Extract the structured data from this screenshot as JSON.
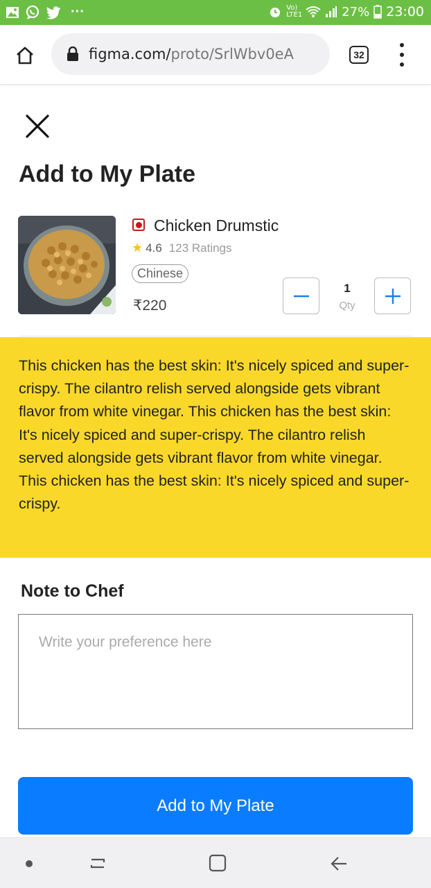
{
  "status_bar": {
    "battery": "27%",
    "time": "23:00",
    "network": "Vo) LTE1",
    "more": "···"
  },
  "browser": {
    "url_domain": "figma.com/",
    "url_path": "proto/SrlWbv0eA",
    "tab_count": "32"
  },
  "page": {
    "title": "Add to My Plate"
  },
  "product": {
    "name": "Chicken Drumstic",
    "rating": "4.6",
    "ratings_count": "123 Ratings",
    "cuisine": "Chinese",
    "price": "₹220",
    "quantity": "1",
    "qty_label": "Qty",
    "description": "This chicken has the best skin: It's nicely spiced and super-crispy. The cilantro relish served alongside gets vibrant flavor from white vinegar. This chicken has the best skin: It's nicely spiced and super-crispy. The cilantro relish served alongside gets vibrant flavor from white vinegar. This chicken has the best skin: It's nicely spiced and super-crispy."
  },
  "note": {
    "label": "Note to Chef",
    "placeholder": "Write your preference here",
    "value": ""
  },
  "cta": {
    "label": "Add to My Plate"
  },
  "colors": {
    "status_bar": "#6cbf45",
    "description_bg": "#f9d829",
    "primary": "#0a7cff",
    "non_veg_marker": "#c21b1b",
    "star": "#f5c518"
  },
  "icons": {
    "status_left": [
      "gallery-icon",
      "whatsapp-icon",
      "twitter-icon"
    ],
    "status_right": [
      "alarm-icon",
      "wifi-icon",
      "signal-icon",
      "battery-icon"
    ],
    "browser": [
      "home-icon",
      "lock-icon",
      "tabs-icon",
      "overflow-menu-icon"
    ],
    "content": [
      "close-icon",
      "star-icon",
      "minus-icon",
      "plus-icon",
      "non-veg-icon"
    ],
    "nav": [
      "nav-dot-icon",
      "recents-icon",
      "home-square-icon",
      "back-arrow-icon"
    ]
  }
}
